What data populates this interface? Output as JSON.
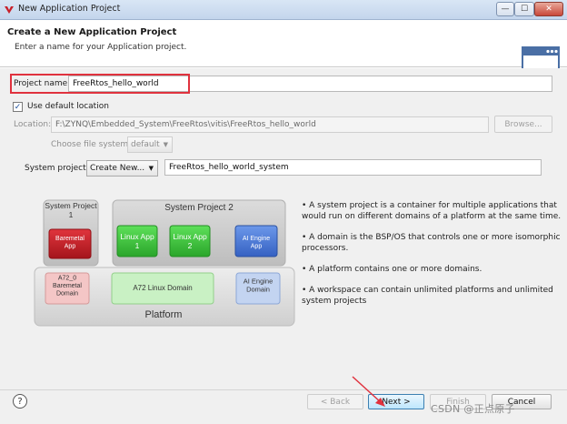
{
  "window": {
    "title": "New Application Project",
    "min_glyph": "—",
    "max_glyph": "☐",
    "close_glyph": "✕"
  },
  "header": {
    "title": "Create a New Application Project",
    "description": "Enter a name for your Application project."
  },
  "form": {
    "project_name_label": "Project name:",
    "project_name_value": "FreeRtos_hello_world",
    "use_default_location_label": "Use default location",
    "use_default_location_checked": true,
    "location_label": "Location:",
    "location_value": "F:\\ZYNQ\\Embedded_System\\FreeRtos\\vitis\\FreeRtos_hello_world",
    "browse_label": "Browse...",
    "file_system_label": "Choose file system:",
    "file_system_value": "default",
    "system_project_label": "System project:",
    "system_project_option": "Create New...",
    "system_project_name": "FreeRtos_hello_world_system"
  },
  "diagram": {
    "system_project_1": "System Project 1",
    "system_project_2": "System Project 2",
    "baremetal_app": "Baremetal App",
    "linux_app_1": "Linux App 1",
    "linux_app_2": "Linux App 2",
    "ai_engine_app": "AI Engine App",
    "a72_baremetal_domain": "A72_0 Baremetal Domain",
    "a72_linux_domain": "A72 Linux Domain",
    "ai_engine_domain": "AI Engine Domain",
    "platform": "Platform"
  },
  "bullets": [
    "• A system project is a container for multiple applications that would run on different domains of a platform at the same time.",
    "• A domain is the BSP/OS that controls one or more isomorphic processors.",
    "• A platform contains one or more domains.",
    "• A workspace can contain unlimited platforms and unlimited system projects"
  ],
  "footer": {
    "help_glyph": "?",
    "back_label": "< Back",
    "next_label": "Next >",
    "finish_label": "Finish",
    "cancel_label": "Cancel"
  },
  "watermark": "CSDN @正点原子",
  "colors": {
    "highlight_red": "#e0323e",
    "baremetal_red": "#c8202a",
    "linux_green": "#3cc43c",
    "ai_blue": "#4577d6",
    "domain_pink": "#f4c6c6",
    "domain_green": "#c9f1c4",
    "domain_blue": "#c3d4f1"
  }
}
